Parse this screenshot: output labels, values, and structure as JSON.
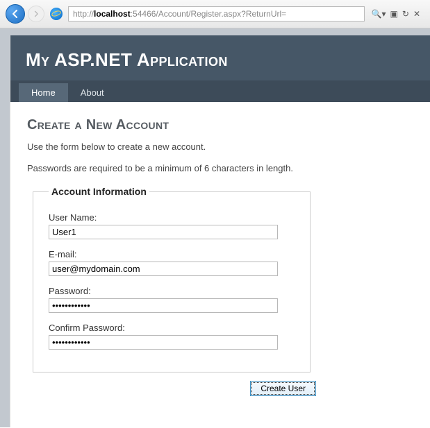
{
  "browser": {
    "url_proto": "http://",
    "url_host": "localhost",
    "url_rest": ":54466/Account/Register.aspx?ReturnUrl="
  },
  "app": {
    "title": "My ASP.NET Application",
    "nav": {
      "home": "Home",
      "about": "About"
    }
  },
  "page": {
    "heading": "Create a New Account",
    "intro": "Use the form below to create a new account.",
    "pw_note": "Passwords are required to be a minimum of 6 characters in length.",
    "legend": "Account Information",
    "fields": {
      "username_label": "User Name:",
      "username_value": "User1",
      "email_label": "E-mail:",
      "email_value": "user@mydomain.com",
      "password_label": "Password:",
      "password_value": "••••••••••••",
      "confirm_label": "Confirm Password:",
      "confirm_value": "••••••••••••"
    },
    "submit_label": "Create User"
  }
}
